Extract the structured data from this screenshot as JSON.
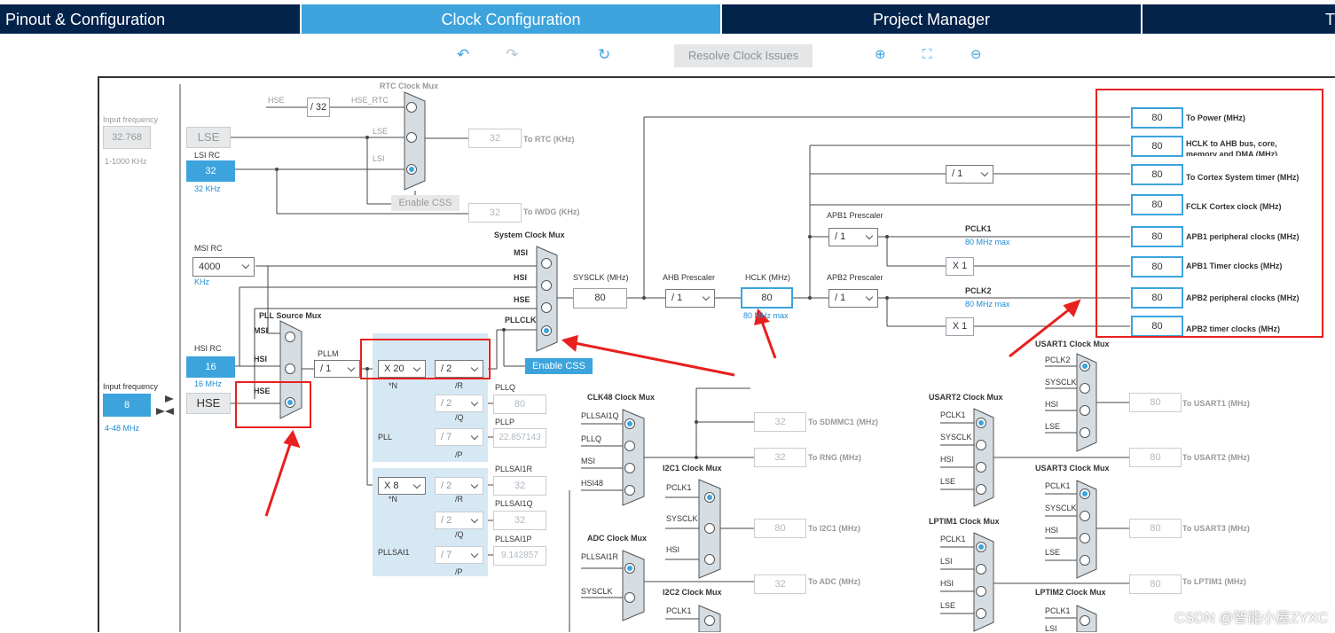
{
  "tabs": [
    {
      "label": "Pinout & Configuration"
    },
    {
      "label": "Clock Configuration"
    },
    {
      "label": "Project Manager"
    },
    {
      "label": "T"
    }
  ],
  "toolbar": {
    "undo_icon": "undo-icon",
    "redo_icon": "redo-icon",
    "reset_icon": "refresh-icon",
    "resolve_label": "Resolve Clock Issues",
    "zoom_in_icon": "zoom-in-icon",
    "fit_icon": "fit-screen-icon",
    "zoom_out_icon": "zoom-out-icon"
  },
  "lse": {
    "input_label": "Input frequency",
    "value": "32.768",
    "range": "1-1000 KHz",
    "name": "LSE"
  },
  "lsi": {
    "name": "LSI RC",
    "value": "32",
    "unit": "32 KHz"
  },
  "msi": {
    "name": "MSI RC",
    "value": "4000",
    "unit": "KHz"
  },
  "hsi": {
    "name": "HSI RC",
    "value": "16",
    "unit": "16 MHz"
  },
  "hse": {
    "input_label": "Input frequency",
    "value": "8",
    "range": "4-48 MHz",
    "name": "HSE"
  },
  "rtc": {
    "mux_label": "RTC Clock Mux",
    "hse": "HSE",
    "div": "/ 32",
    "hse_rtc": "HSE_RTC",
    "lse": "LSE",
    "lsi": "LSI",
    "out": "32",
    "out_label": "To RTC (KHz)",
    "css": "Enable CSS",
    "iwdg": "32",
    "iwdg_label": "To IWDG (KHz)"
  },
  "sysmux": {
    "label": "System Clock Mux",
    "msi": "MSI",
    "hsi": "HSI",
    "hse": "HSE",
    "pllclk": "PLLCLK",
    "css": "Enable CSS"
  },
  "pll": {
    "src_label": "PLL Source Mux",
    "msi": "MSI",
    "hsi": "HSI",
    "hse": "HSE",
    "pllm_label": "PLLM",
    "pllm": "/ 1",
    "n": "X 20",
    "n_label": "*N",
    "r": "/ 2",
    "r_label": "/R",
    "q": "/ 2",
    "q_label": "/Q",
    "p": "/ 7",
    "p_label": "/P",
    "pllq": "PLLQ",
    "pllq_val": "80",
    "pllp": "PLLP",
    "pllp_val": "22.857143",
    "name": "PLL"
  },
  "pllsai1": {
    "n": "X 8",
    "n_label": "*N",
    "r": "/ 2",
    "r_label": "/R",
    "q": "/ 2",
    "q_label": "/Q",
    "p": "/ 7",
    "p_label": "/P",
    "r_name": "PLLSAI1R",
    "r_val": "32",
    "q_name": "PLLSAI1Q",
    "q_val": "32",
    "p_name": "PLLSAI1P",
    "p_val": "9.142857",
    "name": "PLLSAI1"
  },
  "sysclk": {
    "label": "SYSCLK (MHz)",
    "value": "80"
  },
  "ahb": {
    "label": "AHB Prescaler",
    "value": "/ 1"
  },
  "hclk": {
    "label": "HCLK (MHz)",
    "value": "80",
    "max": "80 MHz max"
  },
  "apb1": {
    "label": "APB1 Prescaler",
    "value": "/ 1",
    "pclk": "PCLK1",
    "max": "80 MHz max",
    "x": "X 1"
  },
  "apb2": {
    "label": "APB2 Prescaler",
    "value": "/ 1",
    "pclk": "PCLK2",
    "max": "80 MHz max",
    "x": "X 1"
  },
  "cortex_div": "/ 1",
  "outputs": [
    {
      "value": "80",
      "label": "To Power (MHz)"
    },
    {
      "value": "80",
      "label": "HCLK to AHB bus, core, memory and DMA (MHz)"
    },
    {
      "value": "80",
      "label": "To Cortex System timer (MHz)"
    },
    {
      "value": "80",
      "label": "FCLK Cortex clock (MHz)"
    },
    {
      "value": "80",
      "label": "APB1 peripheral clocks (MHz)"
    },
    {
      "value": "80",
      "label": "APB1 Timer clocks (MHz)"
    },
    {
      "value": "80",
      "label": "APB2 peripheral clocks (MHz)"
    },
    {
      "value": "80",
      "label": "APB2 timer clocks (MHz)"
    }
  ],
  "clk48": {
    "label": "CLK48 Clock Mux",
    "in": [
      "PLLSAI1Q",
      "PLLQ",
      "MSI",
      "HSI48"
    ],
    "sdmmc": "32",
    "sdmmc_label": "To SDMMC1 (MHz)",
    "rng": "32",
    "rng_label": "To RNG (MHz)"
  },
  "i2c1": {
    "label": "I2C1 Clock Mux",
    "in": [
      "PCLK1",
      "SYSCLK",
      "HSI"
    ],
    "out": "80",
    "out_label": "To I2C1 (MHz)"
  },
  "adc": {
    "label": "ADC Clock Mux",
    "in": [
      "PLLSAI1R",
      "SYSCLK"
    ],
    "out": "32",
    "out_label": "To ADC (MHz)"
  },
  "i2c2": {
    "label": "I2C2 Clock Mux",
    "in": [
      "PCLK1"
    ]
  },
  "usart2": {
    "label": "USART2 Clock Mux",
    "in": [
      "PCLK1",
      "SYSCLK",
      "HSI",
      "LSE"
    ],
    "out": "80",
    "out_label": "To USART2 (MHz)"
  },
  "usart1": {
    "label": "USART1 Clock Mux",
    "in": [
      "PCLK2",
      "SYSCLK",
      "HSI",
      "LSE"
    ],
    "out": "80",
    "out_label": "To USART1 (MHz)"
  },
  "usart3": {
    "label": "USART3 Clock Mux",
    "in": [
      "PCLK1",
      "SYSCLK",
      "HSI",
      "LSE"
    ],
    "out": "80",
    "out_label": "To USART3 (MHz)"
  },
  "lptim1": {
    "label": "LPTIM1 Clock Mux",
    "in": [
      "PCLK1",
      "LSI",
      "HSI",
      "LSE"
    ],
    "out": "80",
    "out_label": "To LPTIM1 (MHz)"
  },
  "lptim2": {
    "label": "LPTIM2 Clock Mux",
    "in": [
      "PCLK1",
      "LSI"
    ]
  },
  "watermark": "CSDN @智能小屋ZYXC"
}
